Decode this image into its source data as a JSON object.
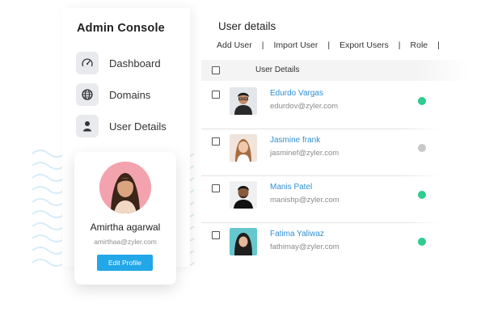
{
  "sidebar": {
    "title": "Admin Console",
    "nav": [
      {
        "label": "Dashboard",
        "icon": "gauge-icon"
      },
      {
        "label": "Domains",
        "icon": "globe-icon"
      },
      {
        "label": "User Details",
        "icon": "user-icon"
      }
    ],
    "profile": {
      "name": "Amirtha agarwal",
      "email": "amirthaa@zyler.com",
      "edit_label": "Edit Profile"
    }
  },
  "main": {
    "title": "User details",
    "toolbar": [
      "Add User",
      "Import User",
      "Export Users",
      "Role"
    ],
    "table": {
      "header": "User Details",
      "rows": [
        {
          "name": "Edurdo Vargas",
          "email": "edurdov@zyler.com",
          "status": "active"
        },
        {
          "name": "Jasmine frank",
          "email": "jasminef@zyler.com",
          "status": "inactive"
        },
        {
          "name": "Manis Patel",
          "email": "manishp@zyler.com",
          "status": "active"
        },
        {
          "name": "Fatima Yaliwaz",
          "email": "fathimay@zyler.com",
          "status": "active"
        }
      ]
    }
  },
  "colors": {
    "accent": "#22a7e8",
    "status_active": "#2ecc8f",
    "status_inactive": "#c9c9c9",
    "link": "#2f8fd3"
  }
}
